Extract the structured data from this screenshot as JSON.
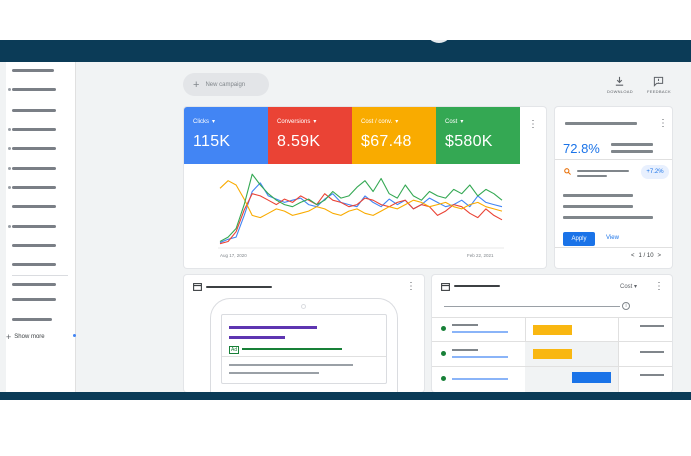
{
  "colors": {
    "frame": "#0b3b57",
    "clicks": "#4285f4",
    "conversions": "#ea4335",
    "cost_per_conv": "#f9ab00",
    "cost": "#34a853",
    "accent": "#1a73e8"
  },
  "sidebar": {
    "show_more_label": "Show more",
    "show_more_icon": "plus-icon"
  },
  "toolbar": {
    "new_campaign_label": "New campaign",
    "new_campaign_icon": "plus-icon",
    "download_label": "DOWNLOAD",
    "download_icon": "download-icon",
    "feedback_label": "FEEDBACK",
    "feedback_icon": "feedback-icon"
  },
  "metrics": [
    {
      "label": "Clicks",
      "value": "115K",
      "color": "#4285f4"
    },
    {
      "label": "Conversions",
      "value": "8.59K",
      "color": "#ea4335"
    },
    {
      "label": "Cost / conv.",
      "value": "$67.48",
      "color": "#f9ab00"
    },
    {
      "label": "Cost",
      "value": "$580K",
      "color": "#34a853"
    }
  ],
  "chart": {
    "start_date": "Aug 17, 2020",
    "end_date": "Feb 22, 2021"
  },
  "chart_data": {
    "type": "line",
    "x": [
      0,
      1,
      2,
      3,
      4,
      5,
      6,
      7,
      8,
      9,
      10,
      11,
      12,
      13,
      14,
      15,
      16,
      17,
      18,
      19,
      20,
      21,
      22,
      23,
      24,
      25,
      26,
      27,
      28,
      29,
      30,
      31,
      32,
      33,
      34,
      35
    ],
    "series": [
      {
        "name": "Clicks",
        "color": "#4285f4",
        "values": [
          5,
          8,
          10,
          30,
          52,
          60,
          48,
          45,
          42,
          44,
          46,
          40,
          38,
          45,
          50,
          42,
          40,
          38,
          48,
          42,
          38,
          45,
          40,
          44,
          36,
          40,
          46,
          42,
          38,
          40,
          44,
          38,
          48,
          42,
          40,
          38
        ]
      },
      {
        "name": "Conversions",
        "color": "#ea4335",
        "values": [
          4,
          6,
          15,
          35,
          50,
          48,
          44,
          40,
          45,
          42,
          48,
          44,
          40,
          50,
          44,
          42,
          38,
          40,
          46,
          44,
          40,
          38,
          42,
          44,
          36,
          40,
          38,
          30,
          34,
          40,
          38,
          32,
          28,
          36,
          30,
          26
        ]
      },
      {
        "name": "Cost / conv.",
        "color": "#f9ab00",
        "values": [
          55,
          62,
          58,
          45,
          30,
          28,
          32,
          36,
          34,
          30,
          32,
          34,
          38,
          36,
          32,
          30,
          34,
          36,
          32,
          30,
          34,
          38,
          36,
          40,
          44,
          42,
          38,
          40,
          42,
          38,
          36,
          40,
          42,
          38,
          36,
          34
        ]
      },
      {
        "name": "Cost",
        "color": "#34a853",
        "values": [
          6,
          10,
          18,
          40,
          68,
          58,
          50,
          44,
          40,
          38,
          42,
          45,
          40,
          44,
          52,
          46,
          48,
          56,
          62,
          52,
          64,
          50,
          46,
          58,
          48,
          44,
          52,
          48,
          46,
          54,
          50,
          58,
          48,
          54,
          50,
          44
        ]
      }
    ]
  },
  "recommendation": {
    "percent": "72.8%",
    "chip": "+7.2%",
    "search_icon": "search-icon",
    "apply_label": "Apply",
    "view_label": "View",
    "pager_text": "1 / 10",
    "prev_icon": "chevron-left-icon",
    "next_icon": "chevron-right-icon"
  },
  "ad_preview": {
    "card_icon": "browser-icon",
    "badge": "Ad"
  },
  "table": {
    "card_icon": "browser-icon",
    "cost_label": "Cost",
    "dropdown_icon": "caret-down-icon",
    "info_icon": "info-icon"
  }
}
